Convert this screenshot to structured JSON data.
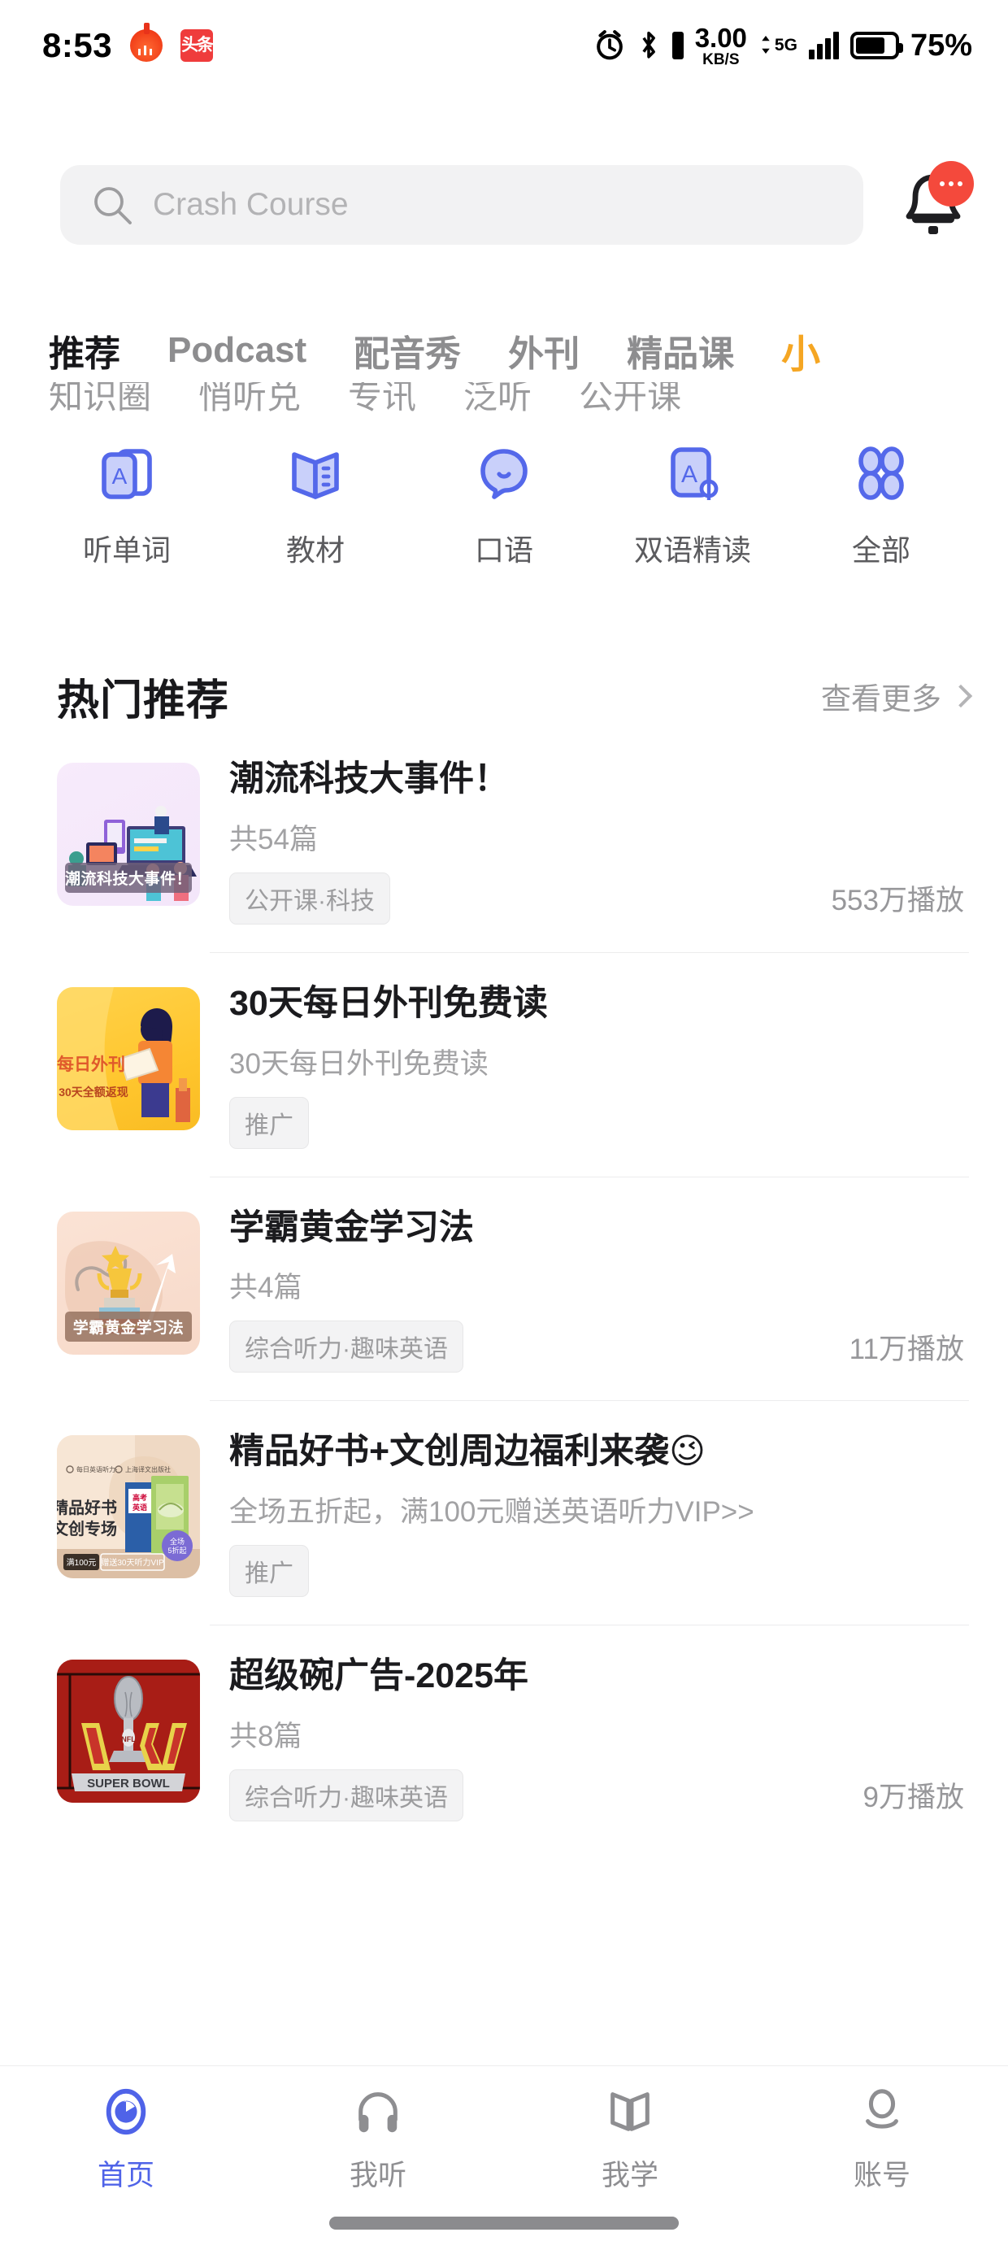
{
  "status_bar": {
    "time": "8:53",
    "app_badge_text": "头条",
    "network_speed": "3.00",
    "network_unit": "KB/S",
    "network_type": "5G",
    "battery_percent": "75%",
    "icons": [
      "alarm-icon",
      "bluetooth-icon",
      "signal-bars-icon",
      "battery-icon"
    ]
  },
  "search": {
    "placeholder": "Crash Course",
    "value": "",
    "icon": "search-icon",
    "bell_icon": "bell-icon",
    "bell_badge": "•••"
  },
  "top_tabs": {
    "items": [
      {
        "label": "推荐",
        "active": true
      },
      {
        "label": "Podcast",
        "active": false
      },
      {
        "label": "配音秀",
        "active": false
      },
      {
        "label": "外刊",
        "active": false
      },
      {
        "label": "精品课",
        "active": false
      }
    ],
    "overflow_glyph": "小"
  },
  "sub_tabs": {
    "items": [
      {
        "label": "知识圈",
        "active": true
      },
      {
        "label": "悄听兑",
        "active": false
      },
      {
        "label": "专讯",
        "active": false
      },
      {
        "label": "泛听",
        "active": false
      },
      {
        "label": "公开课",
        "active": false
      }
    ]
  },
  "categories": [
    {
      "label": "听单词",
      "icon": "word-card-icon"
    },
    {
      "label": "教材",
      "icon": "open-book-icon"
    },
    {
      "label": "口语",
      "icon": "speech-bubble-icon"
    },
    {
      "label": "双语精读",
      "icon": "bilingual-reading-icon"
    },
    {
      "label": "全部",
      "icon": "grid-all-icon"
    }
  ],
  "section": {
    "title": "热门推荐",
    "more_label": "查看更多",
    "more_icon": "chevron-right-icon"
  },
  "items": [
    {
      "title": "潮流科技大事件！",
      "subtitle": "共54篇",
      "tag": "公开课·科技",
      "plays": "553万播放",
      "thumb_caption": "潮流科技大事件！",
      "thumb_class": "tb1",
      "caption_bg": "rgba(110,95,120,0.82)"
    },
    {
      "title": "30天每日外刊免费读",
      "subtitle": "30天每日外刊免费读",
      "tag": "推广",
      "plays": "",
      "thumb_caption": "",
      "thumb_class": "tb2",
      "caption_bg": "transparent"
    },
    {
      "title": "学霸黄金学习法",
      "subtitle": "共4篇",
      "tag": "综合听力·趣味英语",
      "plays": "11万播放",
      "thumb_caption": "学霸黄金学习法",
      "thumb_class": "tb3",
      "caption_bg": "rgba(150,115,96,0.85)"
    },
    {
      "title": "精品好书+文创周边福利来袭😉",
      "subtitle": "全场五折起，满100元赠送英语听力VIP>>",
      "tag": "推广",
      "plays": "",
      "thumb_caption": "",
      "thumb_class": "tb4",
      "caption_bg": "transparent"
    },
    {
      "title": "超级碗广告-2025年",
      "subtitle": "共8篇",
      "tag": "综合听力·趣味英语",
      "plays": "9万播放",
      "thumb_caption": "SUPER BOWL",
      "thumb_class": "tb5",
      "caption_bg": "rgba(205,205,210,0.95)"
    }
  ],
  "thumb_text": {
    "item2_line1": "每日外刊",
    "item2_line2": "30天全额返现",
    "item4_line1": "精品好书",
    "item4_line2": "文创专场",
    "item4_badge1": "满100元",
    "item4_badge2": "赠送30天听力VIP",
    "item4_seal": "全场5折起"
  },
  "bottom_nav": {
    "items": [
      {
        "label": "首页",
        "icon": "home-target-icon",
        "active": true
      },
      {
        "label": "我听",
        "icon": "headphones-icon",
        "active": false
      },
      {
        "label": "我学",
        "icon": "book-icon",
        "active": false
      },
      {
        "label": "账号",
        "icon": "person-icon",
        "active": false
      }
    ]
  },
  "colors": {
    "accent_blue": "#4f63e8",
    "accent_orange": "#f5a623",
    "badge_red": "#f4493c",
    "text_primary": "#1b1b1e",
    "text_muted": "#9a9a9c"
  }
}
